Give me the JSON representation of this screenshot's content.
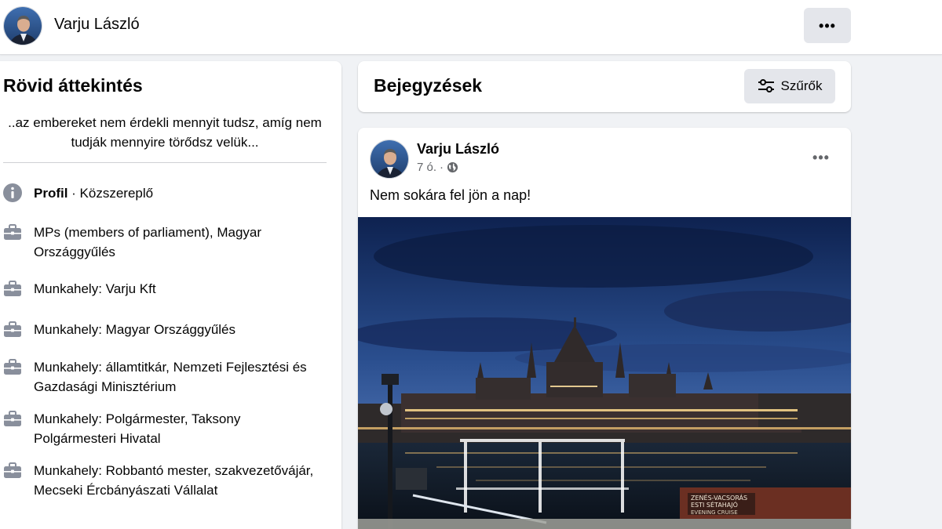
{
  "header": {
    "name": "Varju László",
    "more_icon": "more-dots-icon"
  },
  "intro": {
    "title": "Rövid áttekintés",
    "bio": "..az embereket nem érdekli mennyit tudsz, amíg nem tudják mennyire törődsz velük...",
    "profile_label": "Profil",
    "profile_category": " · Közszereplő",
    "items": [
      {
        "icon": "briefcase-icon",
        "text": "MPs (members of parliament), Magyar Országgyűlés"
      },
      {
        "icon": "briefcase-icon",
        "text": "Munkahely: Varju Kft"
      },
      {
        "icon": "briefcase-icon",
        "text": "Munkahely: Magyar Országgyűlés"
      },
      {
        "icon": "briefcase-icon",
        "text": "Munkahely: államtitkár, Nemzeti Fejlesztési és Gazdasági Minisztérium"
      },
      {
        "icon": "briefcase-icon",
        "text": "Munkahely: Polgármester, Taksony Polgármesteri Hivatal"
      },
      {
        "icon": "briefcase-icon",
        "text": "Munkahely: Robbantó mester, szakvezetővájár, Mecseki Ércbányászati Vállalat"
      }
    ]
  },
  "posts_header": {
    "title": "Bejegyzések",
    "filter_label": "Szűrők"
  },
  "post": {
    "author": "Varju László",
    "time": "7 ó.",
    "separator": "·",
    "text": "Nem sokára fel jön a nap!",
    "photo_signs": [
      "ZENÉS-VACSORÁS",
      "ESTI SÉTAHAJÓ",
      "EVENING CRUISE"
    ]
  },
  "colors": {
    "page_bg": "#f0f2f5",
    "card_bg": "#ffffff",
    "button_bg": "#e4e6eb",
    "secondary_text": "#65676b",
    "icon_gray": "#898f9c"
  }
}
